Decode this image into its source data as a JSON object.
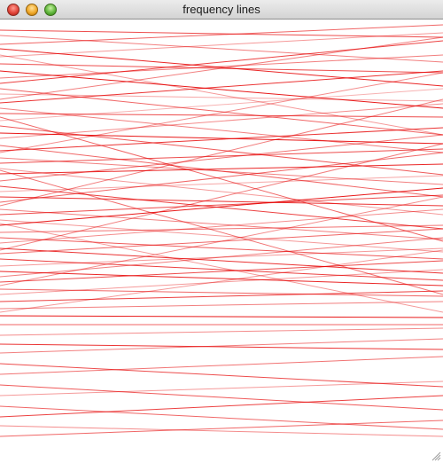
{
  "window": {
    "title": "frequency lines"
  },
  "colors": {
    "line": "#e60000",
    "background": "#ffffff"
  },
  "icons": {
    "close": "close-icon",
    "minimize": "minimize-icon",
    "zoom": "zoom-icon",
    "resize": "resize-grip-icon"
  }
}
